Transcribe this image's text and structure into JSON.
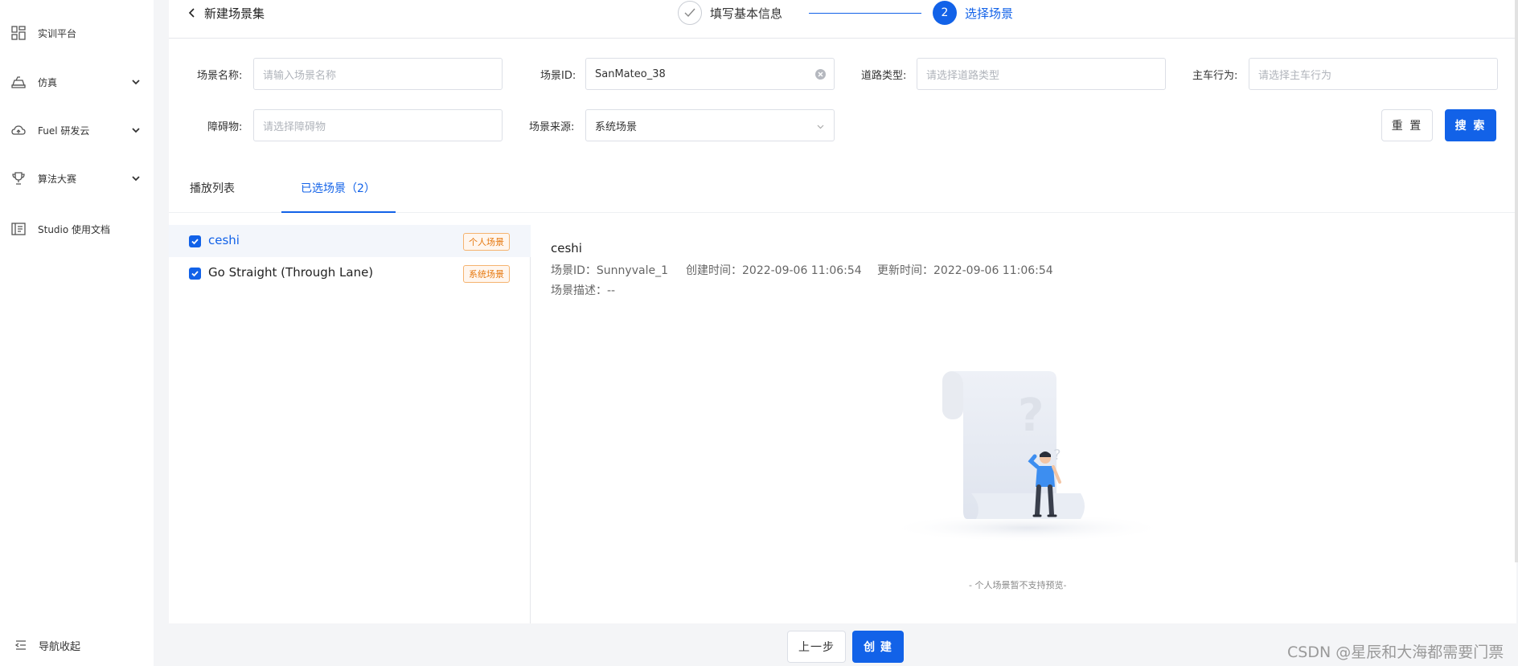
{
  "sidebar": {
    "items": [
      {
        "label": "实训平台",
        "icon": "dashboard-icon"
      },
      {
        "label": "仿真",
        "icon": "car-icon"
      },
      {
        "label": "Fuel 研发云",
        "icon": "cloud-icon"
      },
      {
        "label": "算法大赛",
        "icon": "trophy-icon"
      },
      {
        "label": "Studio 使用文档",
        "icon": "document-icon"
      }
    ],
    "collapse_label": "导航收起"
  },
  "header": {
    "back_label": "新建场景集",
    "steps": [
      {
        "label": "填写基本信息",
        "status": "done"
      },
      {
        "number": "2",
        "label": "选择场景",
        "status": "active"
      }
    ]
  },
  "filters": {
    "scene_name": {
      "label": "场景名称:",
      "placeholder": "请输入场景名称"
    },
    "scene_id": {
      "label": "场景ID:",
      "value": "SanMateo_38"
    },
    "road_type": {
      "label": "道路类型:",
      "placeholder": "请选择道路类型"
    },
    "ego_behavior": {
      "label": "主车行为:",
      "placeholder": "请选择主车行为"
    },
    "obstacle": {
      "label": "障碍物:",
      "placeholder": "请选择障碍物"
    },
    "scene_source": {
      "label": "场景来源:",
      "value": "系统场景"
    },
    "reset_label": "重 置",
    "search_label": "搜 索"
  },
  "tabs": [
    {
      "label": "播放列表"
    },
    {
      "label": "已选场景（2）",
      "active": true
    }
  ],
  "selected_scenes": [
    {
      "name": "ceshi",
      "tag": "个人场景",
      "checked": true,
      "selected": true
    },
    {
      "name": "Go Straight (Through Lane)",
      "tag": "系统场景",
      "checked": true,
      "selected": false
    }
  ],
  "detail": {
    "title": "ceshi",
    "scene_id": "场景ID：Sunnyvale_1",
    "created": "创建时间：2022-09-06 11:06:54",
    "updated": "更新时间：2022-09-06 11:06:54",
    "description": "场景描述：--",
    "empty_text": "- 个人场景暂不支持预览-"
  },
  "footer": {
    "prev_label": "上一步",
    "create_label": "创 建"
  },
  "watermark": "CSDN @星辰和大海都需要门票",
  "colors": {
    "accent": "#1262e8",
    "tag_orange": "#e6780f"
  }
}
